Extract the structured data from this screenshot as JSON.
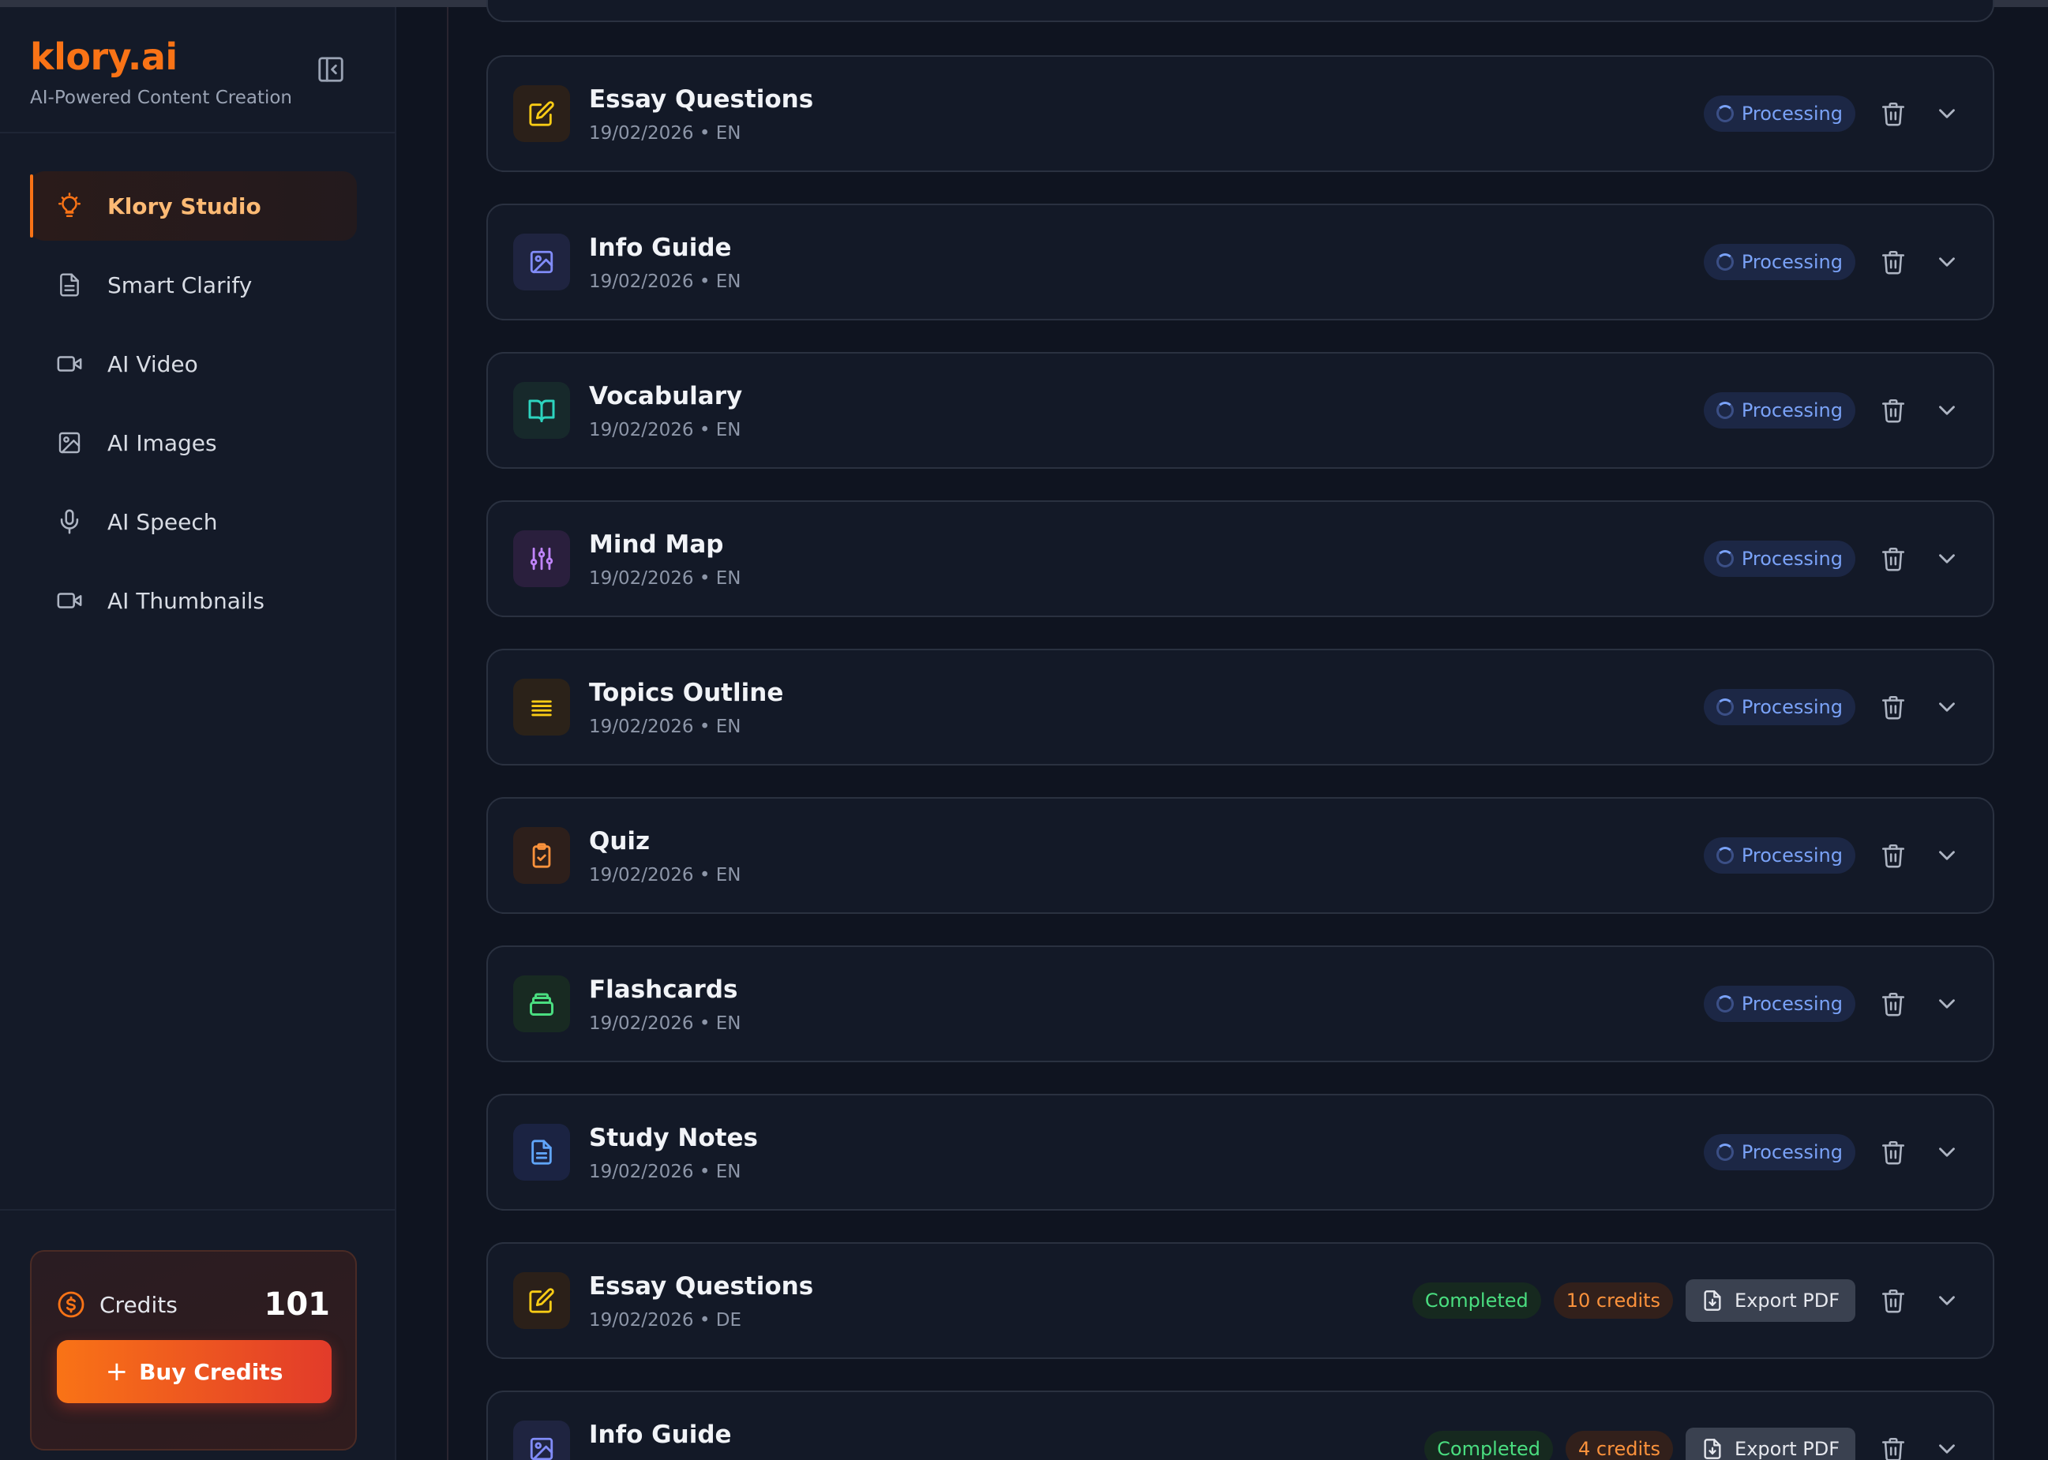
{
  "app": {
    "brand": "klory.ai",
    "tagline": "AI-Powered Content Creation"
  },
  "sidebar": {
    "items": [
      {
        "label": "Klory Studio",
        "icon": "lightbulb-icon",
        "active": true
      },
      {
        "label": "Smart Clarify",
        "icon": "document-icon",
        "active": false
      },
      {
        "label": "AI Video",
        "icon": "video-icon",
        "active": false
      },
      {
        "label": "AI Images",
        "icon": "image-icon",
        "active": false
      },
      {
        "label": "AI Speech",
        "icon": "microphone-icon",
        "active": false
      },
      {
        "label": "AI Thumbnails",
        "icon": "video-icon",
        "active": false
      }
    ],
    "credits": {
      "label": "Credits",
      "value": "101",
      "buy_label": "Buy Credits"
    }
  },
  "items": [
    {
      "title": "Essay Questions",
      "meta": "19/02/2026 • EN",
      "icon": "pencil-square-icon",
      "status": "Processing"
    },
    {
      "title": "Info Guide",
      "meta": "19/02/2026 • EN",
      "icon": "image-icon",
      "status": "Processing"
    },
    {
      "title": "Vocabulary",
      "meta": "19/02/2026 • EN",
      "icon": "book-open-icon",
      "status": "Processing"
    },
    {
      "title": "Mind Map",
      "meta": "19/02/2026 • EN",
      "icon": "sliders-icon",
      "status": "Processing"
    },
    {
      "title": "Topics Outline",
      "meta": "19/02/2026 • EN",
      "icon": "list-lines-icon",
      "status": "Processing"
    },
    {
      "title": "Quiz",
      "meta": "19/02/2026 • EN",
      "icon": "clipboard-check-icon",
      "status": "Processing"
    },
    {
      "title": "Flashcards",
      "meta": "19/02/2026 • EN",
      "icon": "card-stack-icon",
      "status": "Processing"
    },
    {
      "title": "Study Notes",
      "meta": "19/02/2026 • EN",
      "icon": "document-icon",
      "status": "Processing"
    },
    {
      "title": "Essay Questions",
      "meta": "19/02/2026 • DE",
      "icon": "pencil-square-icon",
      "status": "Completed",
      "credits": "10 credits",
      "export_label": "Export PDF"
    },
    {
      "title": "Info Guide",
      "meta": "",
      "icon": "image-icon",
      "status": "Completed",
      "credits": "4 credits",
      "export_label": "Export PDF"
    }
  ],
  "colors": {
    "accent": "#f97316",
    "processing": "#7aa2f7",
    "completed": "#4ade80",
    "credits": "#fb923c"
  }
}
